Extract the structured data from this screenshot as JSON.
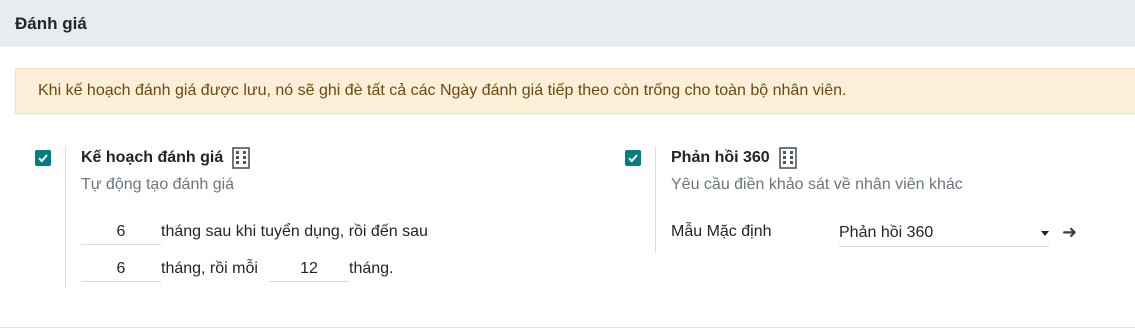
{
  "section": {
    "title": "Đánh giá"
  },
  "alert": {
    "text": "Khi kế hoạch đánh giá được lưu, nó sẽ ghi đè tất cả các Ngày đánh giá tiếp theo còn trống cho toàn bộ nhân viên."
  },
  "appraisal_plan": {
    "checked": true,
    "title": "Kế hoạch đánh giá",
    "description": "Tự động tạo đánh giá",
    "first_months": "6",
    "first_text": "tháng sau khi tuyển dụng, rồi đến sau",
    "second_months": "6",
    "second_text": "tháng, rồi mỗi",
    "repeat_months": "12",
    "repeat_text": "tháng."
  },
  "feedback_360": {
    "checked": true,
    "title": "Phản hồi 360",
    "description": "Yêu cầu điền khảo sát về nhân viên khác",
    "template_label": "Mẫu Mặc định",
    "template_value": "Phản hồi 360"
  },
  "icons": {
    "checkbox": "checkmark-icon",
    "company": "building-icon",
    "dropdown": "caret-down-icon",
    "open_record": "arrow-right-icon"
  },
  "colors": {
    "accent": "#017e84",
    "alert_bg": "#fcefd7",
    "alert_text": "#6a4a10"
  }
}
